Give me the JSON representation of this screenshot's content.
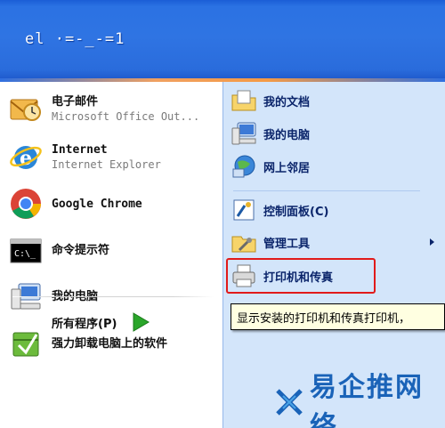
{
  "header": {
    "user_name": "el ·=-_-=1"
  },
  "left_pane": {
    "items": [
      {
        "title": "电子邮件",
        "subtitle": "Microsoft Office Out...",
        "icon": "outlook-mail-icon"
      },
      {
        "title": "Internet",
        "subtitle": "Internet Explorer",
        "icon": "internet-explorer-icon"
      },
      {
        "title": "Google Chrome",
        "subtitle": "",
        "icon": "google-chrome-icon"
      },
      {
        "title": "命令提示符",
        "subtitle": "",
        "icon": "command-prompt-icon"
      },
      {
        "title": "我的电脑",
        "subtitle": "",
        "icon": "my-computer-icon"
      },
      {
        "title": "强力卸载电脑上的软件",
        "subtitle": "",
        "icon": "uninstall-software-icon"
      }
    ],
    "all_programs": "所有程序(P)"
  },
  "right_pane": {
    "items": [
      {
        "label": "我的文档",
        "icon": "my-documents-icon"
      },
      {
        "label": "我的电脑",
        "icon": "my-computer-icon"
      },
      {
        "label": "网上邻居",
        "icon": "network-places-icon"
      },
      {
        "label": "控制面板(C)",
        "icon": "control-panel-icon"
      },
      {
        "label": "管理工具",
        "icon": "admin-tools-icon"
      },
      {
        "label": "打印机和传真",
        "icon": "printer-fax-icon"
      }
    ]
  },
  "tooltip": {
    "text": "显示安装的打印机和传真打印机，"
  },
  "watermark": {
    "text": "易企推网络"
  },
  "colors": {
    "header_blue": "#2f74e3",
    "right_pane_bg": "#d3e5fa",
    "highlight_red": "#e11a1a",
    "hover_blue": "#316ac5"
  }
}
